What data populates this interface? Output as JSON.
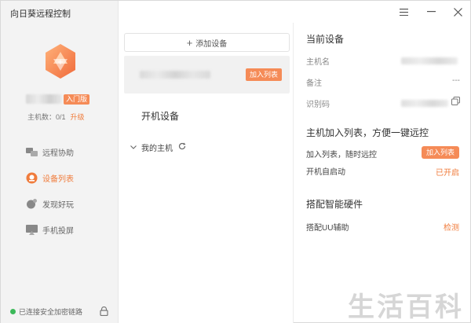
{
  "app": {
    "title": "向日葵远程控制"
  },
  "window_controls": {
    "menu_icon": "menu-icon",
    "minimize_icon": "minimize-icon",
    "close_icon": "close-icon"
  },
  "sidebar": {
    "user": {
      "plan_badge": "入门版"
    },
    "host_count": "主机数：0/1",
    "upgrade_label": "升级",
    "nav": [
      {
        "label": "远程协助",
        "icon": "remote-assist-icon"
      },
      {
        "label": "设备列表",
        "icon": "device-list-icon",
        "active": true
      },
      {
        "label": "发现好玩",
        "icon": "discover-icon"
      },
      {
        "label": "手机投屏",
        "icon": "screen-cast-icon"
      }
    ],
    "status": "已连接安全加密链路",
    "status_color": "#3cb95a"
  },
  "middle": {
    "add_device_label": "添加设备",
    "device_card": {
      "join_label": "加入列表"
    },
    "boot_devices_title": "开机设备",
    "my_hosts_label": "我的主机"
  },
  "right": {
    "current_device": {
      "title": "当前设备",
      "host_name_label": "主机名",
      "remark_label": "备注",
      "remark_value": "---",
      "id_code_label": "识别码"
    },
    "join_section": {
      "title": "主机加入列表，方便一键远控",
      "join_label": "加入列表，随时远控",
      "join_button": "加入列表",
      "autostart_label": "开机自启动",
      "autostart_value": "已开启"
    },
    "hardware": {
      "title": "搭配智能硬件",
      "uu_label": "搭配UU辅助",
      "detect_label": "检测"
    }
  },
  "accent_color": "#f58b57",
  "watermark": "生活百科"
}
